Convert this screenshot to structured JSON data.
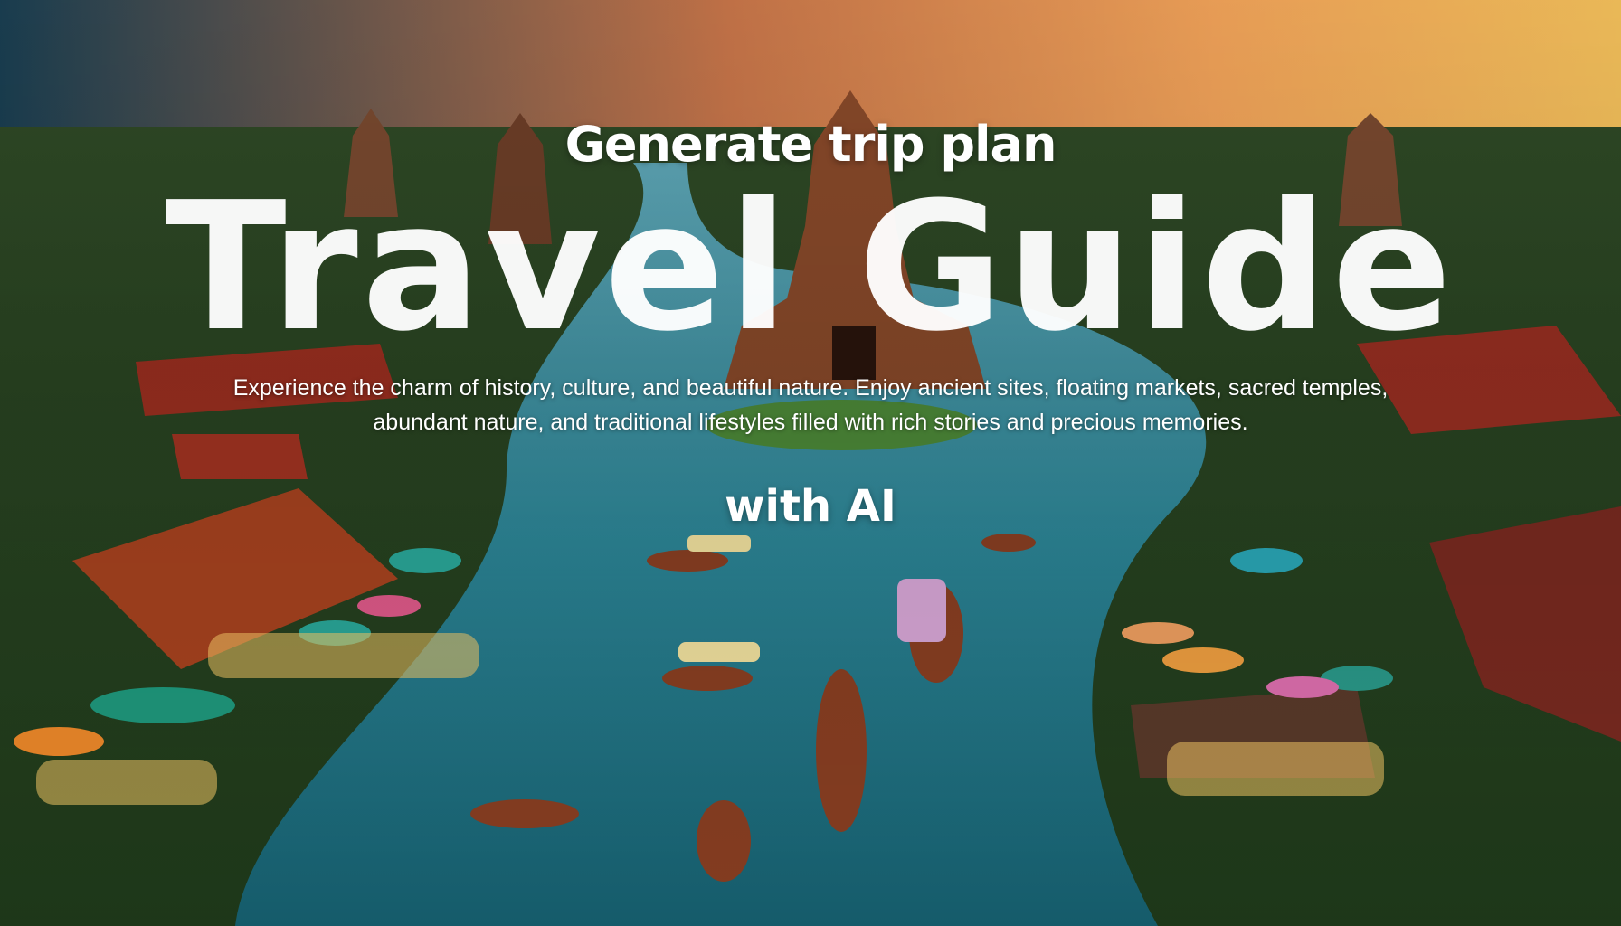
{
  "hero": {
    "eyebrow": "Generate trip plan",
    "title": "Travel Guide",
    "description": "Experience the charm of history, culture, and beautiful nature. Enjoy ancient sites, floating markets, sacred temples, abundant nature, and traditional lifestyles filled with rich stories and precious memories.",
    "tagline": "with AI"
  }
}
